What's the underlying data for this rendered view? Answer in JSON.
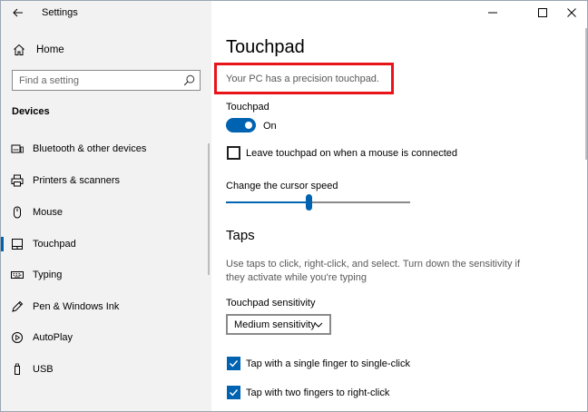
{
  "app": {
    "title": "Settings"
  },
  "sidebar": {
    "home_label": "Home",
    "search_placeholder": "Find a setting",
    "section_title": "Devices",
    "items": [
      {
        "label": "Bluetooth & other devices",
        "icon": "bluetooth-devices-icon",
        "selected": false
      },
      {
        "label": "Printers & scanners",
        "icon": "printer-icon",
        "selected": false
      },
      {
        "label": "Mouse",
        "icon": "mouse-icon",
        "selected": false
      },
      {
        "label": "Touchpad",
        "icon": "touchpad-icon",
        "selected": true
      },
      {
        "label": "Typing",
        "icon": "keyboard-icon",
        "selected": false
      },
      {
        "label": "Pen & Windows Ink",
        "icon": "pen-icon",
        "selected": false
      },
      {
        "label": "AutoPlay",
        "icon": "autoplay-icon",
        "selected": false
      },
      {
        "label": "USB",
        "icon": "usb-icon",
        "selected": false
      }
    ]
  },
  "main": {
    "title": "Touchpad",
    "precision_text": "Your PC has a precision touchpad.",
    "touchpad_label": "Touchpad",
    "toggle_state": "On",
    "toggle_on": true,
    "leave_on_label": "Leave touchpad on when a mouse is connected",
    "leave_on_checked": false,
    "cursor_speed_label": "Change the cursor speed",
    "cursor_speed_fraction": 0.45,
    "taps_heading": "Taps",
    "taps_description": "Use taps to click, right-click, and select. Turn down the sensitivity if they activate while you're typing",
    "sensitivity_label": "Touchpad sensitivity",
    "sensitivity_value": "Medium sensitivity",
    "tap_single_label": "Tap with a single finger to single-click",
    "tap_single_checked": true,
    "tap_two_label": "Tap with two fingers to right-click",
    "tap_two_checked": true
  },
  "colors": {
    "accent": "#0063b1",
    "highlight": "#e8141a",
    "sidebar_bg": "#f2f2f2"
  }
}
